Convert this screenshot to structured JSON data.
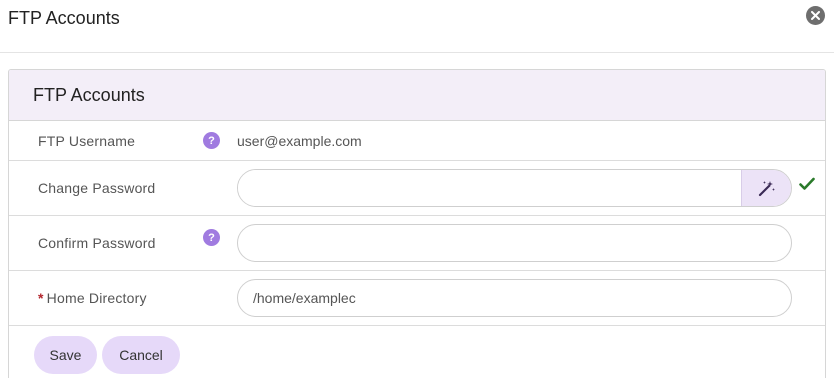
{
  "dialog": {
    "title": "FTP Accounts"
  },
  "panel": {
    "title": "FTP Accounts",
    "fields": {
      "username": {
        "label": "FTP Username",
        "value": "user@example.com"
      },
      "change_password": {
        "label": "Change Password",
        "value": ""
      },
      "confirm_password": {
        "label": "Confirm Password",
        "value": ""
      },
      "home_directory": {
        "label": "Home Directory",
        "required_mark": "*",
        "value": "/home/examplec"
      }
    }
  },
  "actions": {
    "save": "Save",
    "cancel": "Cancel"
  },
  "icons": {
    "close": "close-icon",
    "help": "question-mark-icon",
    "generate": "magic-wand-icon",
    "valid": "checkmark-icon"
  },
  "colors": {
    "accent": "#a07be0",
    "button_bg": "#e6d9f9",
    "panel_heading_bg": "#f3eef8",
    "required": "#b3262d",
    "success": "#2a7a2a"
  }
}
